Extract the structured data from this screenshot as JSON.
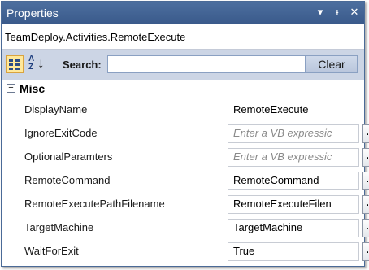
{
  "title": "Properties",
  "title_buttons": [
    "▾",
    "ᵼ",
    "✕"
  ],
  "object_name": "TeamDeploy.Activities.RemoteExecute",
  "toolbar": {
    "search_label": "Search:",
    "search_value": "",
    "clear_label": "Clear"
  },
  "category": {
    "toggle": "−",
    "label": "Misc"
  },
  "properties": [
    {
      "name": "DisplayName",
      "value": "RemoteExecute",
      "kind": "plain",
      "button": ""
    },
    {
      "name": "IgnoreExitCode",
      "value": "Enter a VB expressic",
      "kind": "placeholder",
      "button": "..."
    },
    {
      "name": "OptionalParamters",
      "value": "Enter a VB expressic",
      "kind": "placeholder",
      "button": "..."
    },
    {
      "name": "RemoteCommand",
      "value": "RemoteCommand",
      "kind": "value",
      "button": "..."
    },
    {
      "name": "RemoteExecutePathFilename",
      "value": "RemoteExecuteFilen",
      "kind": "value",
      "button": "..."
    },
    {
      "name": "TargetMachine",
      "value": "TargetMachine",
      "kind": "value",
      "button": "..."
    },
    {
      "name": "WaitForExit",
      "value": "True",
      "kind": "value",
      "button": "..."
    }
  ],
  "colors": {
    "titlebar": "#3f6090",
    "toolbar": "#ccd5e5",
    "placeholder_text": "#8a8a8a"
  }
}
